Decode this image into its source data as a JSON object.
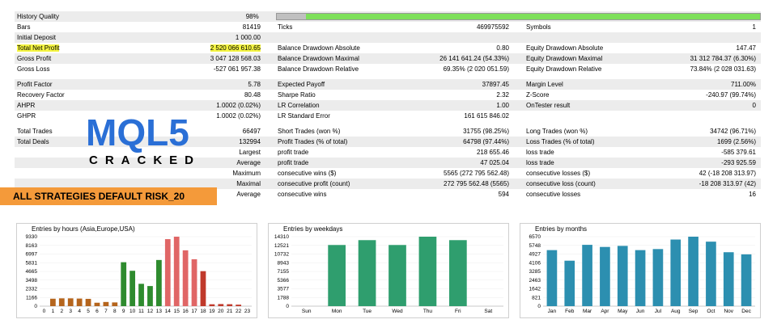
{
  "report": {
    "rows": [
      {
        "c1": "History Quality",
        "c2": "98%",
        "c3": "",
        "c4": "",
        "c5": "",
        "c6": "",
        "shade": true,
        "bar": true
      },
      {
        "c1": "Bars",
        "c2": "81419",
        "c3": "Ticks",
        "c4": "469975592",
        "c5": "Symbols",
        "c6": "1",
        "shade": false
      },
      {
        "c1": "Initial Deposit",
        "c2": "1 000.00",
        "c3": "",
        "c4": "",
        "c5": "",
        "c6": "",
        "shade": true
      },
      {
        "c1": "Total Net Profit",
        "c2": "2 520 066 610.65",
        "c3": "Balance Drawdown Absolute",
        "c4": "0.80",
        "c5": "Equity Drawdown Absolute",
        "c6": "147.47",
        "shade": false,
        "highlight": true
      },
      {
        "c1": "Gross Profit",
        "c2": "3 047 128 568.03",
        "c3": "Balance Drawdown Maximal",
        "c4": "26 141 641.24 (54.33%)",
        "c5": "Equity Drawdown Maximal",
        "c6": "31 312 784.37 (6.30%)",
        "shade": true
      },
      {
        "c1": "Gross Loss",
        "c2": "-527 061 957.38",
        "c3": "Balance Drawdown Relative",
        "c4": "69.35% (2 020 051.59)",
        "c5": "Equity Drawdown Relative",
        "c6": "73.84% (2 028 031.63)",
        "shade": false
      },
      {
        "gap": true
      },
      {
        "c1": "Profit Factor",
        "c2": "5.78",
        "c3": "Expected Payoff",
        "c4": "37897.45",
        "c5": "Margin Level",
        "c6": "711.00%",
        "shade": true
      },
      {
        "c1": "Recovery Factor",
        "c2": "80.48",
        "c3": "Sharpe Ratio",
        "c4": "2.32",
        "c5": "Z-Score",
        "c6": "-240.97 (99.74%)",
        "shade": false
      },
      {
        "c1": "AHPR",
        "c2": "1.0002 (0.02%)",
        "c3": "LR Correlation",
        "c4": "1.00",
        "c5": "OnTester result",
        "c6": "0",
        "shade": true
      },
      {
        "c1": "GHPR",
        "c2": "1.0002 (0.02%)",
        "c3": "LR Standard Error",
        "c4": "161 615 846.02",
        "c5": "",
        "c6": "",
        "shade": false
      },
      {
        "gap": true
      },
      {
        "c1": "Total Trades",
        "c2": "66497",
        "c3": "Short Trades (won %)",
        "c4": "31755 (98.25%)",
        "c5": "Long Trades (won %)",
        "c6": "34742 (96.71%)",
        "shade": false
      },
      {
        "c1": "Total Deals",
        "c2": "132994",
        "c3": "Profit Trades (% of total)",
        "c4": "64798 (97.44%)",
        "c5": "Loss Trades (% of total)",
        "c6": "1699 (2.56%)",
        "shade": true
      },
      {
        "c1": "",
        "c2": "Largest",
        "c3": "profit trade",
        "c4": "218 655.46",
        "c5": "loss trade",
        "c6": "-585 379.61",
        "shade": false
      },
      {
        "c1": "",
        "c2": "Average",
        "c3": "profit trade",
        "c4": "47 025.04",
        "c5": "loss trade",
        "c6": "-293 925.59",
        "shade": true
      },
      {
        "c1": "",
        "c2": "Maximum",
        "c3": "consecutive wins ($)",
        "c4": "5565 (272 795 562.48)",
        "c5": "consecutive losses ($)",
        "c6": "42 (-18 208 313.97)",
        "shade": false
      },
      {
        "c1": "",
        "c2": "Maximal",
        "c3": "consecutive profit (count)",
        "c4": "272 795 562.48 (5565)",
        "c5": "consecutive loss (count)",
        "c6": "-18 208 313.97 (42)",
        "shade": true
      },
      {
        "c1": "",
        "c2": "Average",
        "c3": "consecutive wins",
        "c4": "594",
        "c5": "consecutive losses",
        "c6": "16",
        "shade": false
      }
    ]
  },
  "banner": "ALL STRATEGIES DEFAULT RISK_20",
  "logo": {
    "text": "MQL5",
    "sub": "CRACKED"
  },
  "chart_data": [
    {
      "type": "bar",
      "title": "Entries by hours (Asia,Europe,USA)",
      "categories": [
        "0",
        "1",
        "2",
        "3",
        "4",
        "5",
        "6",
        "7",
        "8",
        "9",
        "10",
        "11",
        "12",
        "13",
        "14",
        "15",
        "16",
        "17",
        "18",
        "19",
        "20",
        "21",
        "22",
        "23"
      ],
      "values": [
        0,
        1000,
        1050,
        1050,
        1020,
        980,
        460,
        560,
        500,
        5900,
        4750,
        3000,
        2700,
        6200,
        9000,
        9330,
        7500,
        6300,
        4700,
        250,
        280,
        260,
        200,
        0
      ],
      "colors": [
        "#b5651d",
        "#b5651d",
        "#b5651d",
        "#b5651d",
        "#b5651d",
        "#b5651d",
        "#b5651d",
        "#b5651d",
        "#b5651d",
        "#2e8b2e",
        "#2e8b2e",
        "#2e8b2e",
        "#2e8b2e",
        "#2e8b2e",
        "#e06666",
        "#e06666",
        "#e06666",
        "#e06666",
        "#c0392b",
        "#c0392b",
        "#c0392b",
        "#c0392b",
        "#c0392b",
        "#c0392b"
      ],
      "yticks": [
        "0",
        "1166",
        "2332",
        "3498",
        "4665",
        "5831",
        "6997",
        "8163",
        "9330"
      ],
      "ylim": [
        0,
        9330
      ]
    },
    {
      "type": "bar",
      "title": "Entries by weekdays",
      "categories": [
        "Sun",
        "Mon",
        "Tue",
        "Wed",
        "Thu",
        "Fri",
        "Sat"
      ],
      "values": [
        0,
        12600,
        13600,
        12600,
        14310,
        13600,
        0
      ],
      "color": "#2f9e6e",
      "yticks": [
        "0",
        "1788",
        "3577",
        "5366",
        "7155",
        "8943",
        "10732",
        "12521",
        "14310"
      ],
      "ylim": [
        0,
        14310
      ]
    },
    {
      "type": "bar",
      "title": "Entries by months",
      "categories": [
        "Jan",
        "Feb",
        "Mar",
        "Apr",
        "May",
        "Jun",
        "Jul",
        "Aug",
        "Sep",
        "Oct",
        "Nov",
        "Dec"
      ],
      "values": [
        5300,
        4300,
        5800,
        5600,
        5700,
        5300,
        5400,
        6300,
        6570,
        6100,
        5100,
        4900
      ],
      "color": "#2c8fb0",
      "yticks": [
        "0",
        "821",
        "1642",
        "2463",
        "3285",
        "4106",
        "4927",
        "5748",
        "6570"
      ],
      "ylim": [
        0,
        6570
      ]
    }
  ]
}
